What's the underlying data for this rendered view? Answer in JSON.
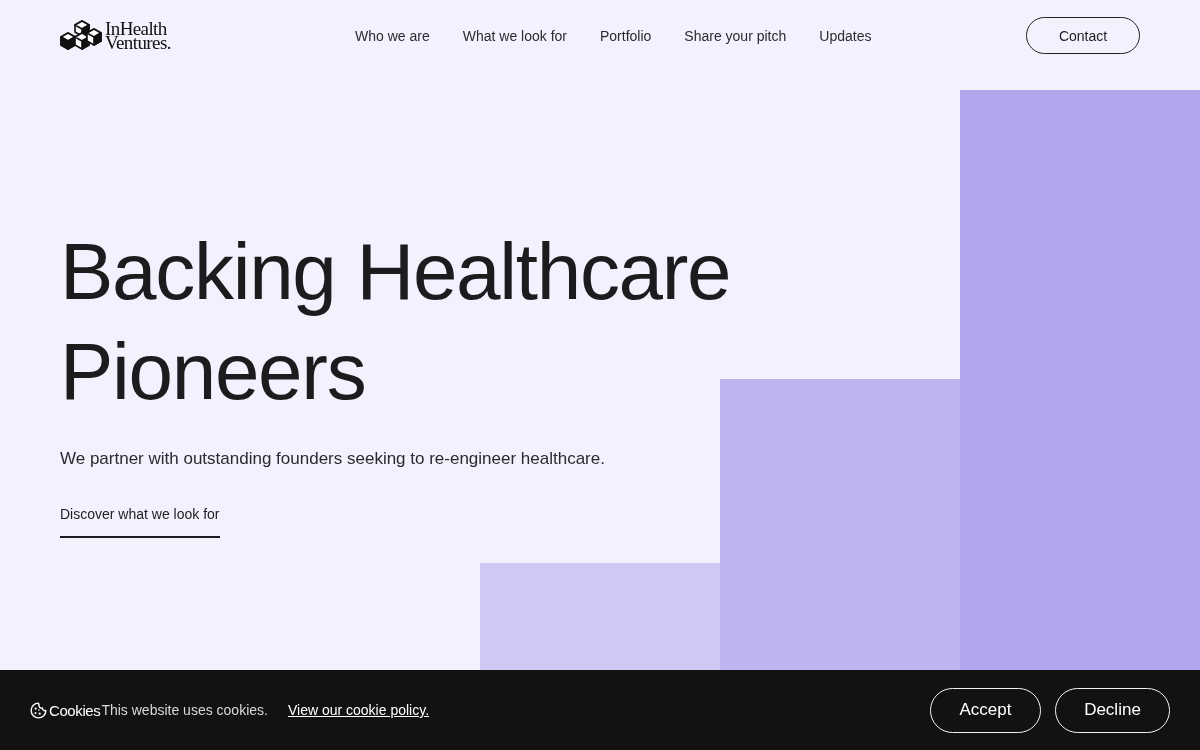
{
  "header": {
    "logo": {
      "lines": [
        "InHealth",
        "Ventures."
      ]
    },
    "nav": [
      {
        "label": "Who we are"
      },
      {
        "label": "What we look for"
      },
      {
        "label": "Portfolio"
      },
      {
        "label": "Share your pitch"
      },
      {
        "label": "Updates"
      }
    ],
    "contact_button": "Contact"
  },
  "hero": {
    "heading": "Backing Healthcare Pioneers",
    "subtitle": "We partner with outstanding founders seeking to re-engineer healthcare.",
    "link": "Discover what we look for"
  },
  "cookie_banner": {
    "title": "Cookies",
    "message": "This website uses cookies.",
    "policy_link": "View our cookie policy.",
    "buttons": [
      {
        "label": "Accept",
        "kind": "accept"
      },
      {
        "label": "Decline",
        "kind": "decline"
      }
    ]
  }
}
